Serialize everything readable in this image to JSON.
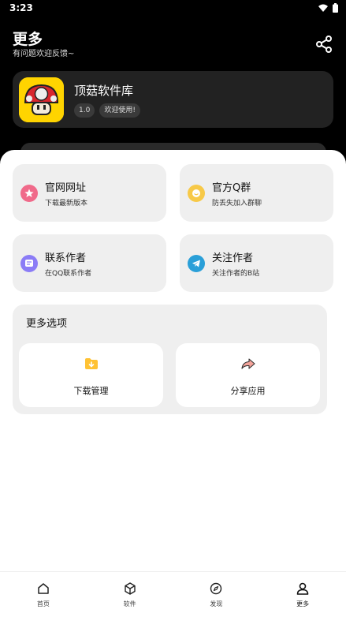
{
  "status": {
    "time": "3:23"
  },
  "header": {
    "title": "更多",
    "subtitle": "有问题欢迎反馈~"
  },
  "app": {
    "name": "顶菇软件库",
    "version": "1.0",
    "welcome": "欢迎使用!"
  },
  "tiles": [
    {
      "title": "官网网址",
      "desc": "下载最新版本",
      "icon": "star-icon",
      "color": "#f06a8a"
    },
    {
      "title": "官方Q群",
      "desc": "防丢失加入群聊",
      "icon": "smile-icon",
      "color": "#f7c948"
    },
    {
      "title": "联系作者",
      "desc": "在QQ联系作者",
      "icon": "chat-icon",
      "color": "#8b7cf6"
    },
    {
      "title": "关注作者",
      "desc": "关注作者的B站",
      "icon": "telegram-icon",
      "color": "#2a9fd8"
    }
  ],
  "more_options": {
    "title": "更多选项",
    "items": [
      {
        "label": "下载管理",
        "icon": "download-folder-icon"
      },
      {
        "label": "分享应用",
        "icon": "share-arrow-icon"
      }
    ]
  },
  "nav": [
    {
      "label": "首页",
      "icon": "home-icon"
    },
    {
      "label": "软件",
      "icon": "cube-icon"
    },
    {
      "label": "发现",
      "icon": "compass-icon"
    },
    {
      "label": "更多",
      "icon": "user-icon",
      "active": true
    }
  ]
}
